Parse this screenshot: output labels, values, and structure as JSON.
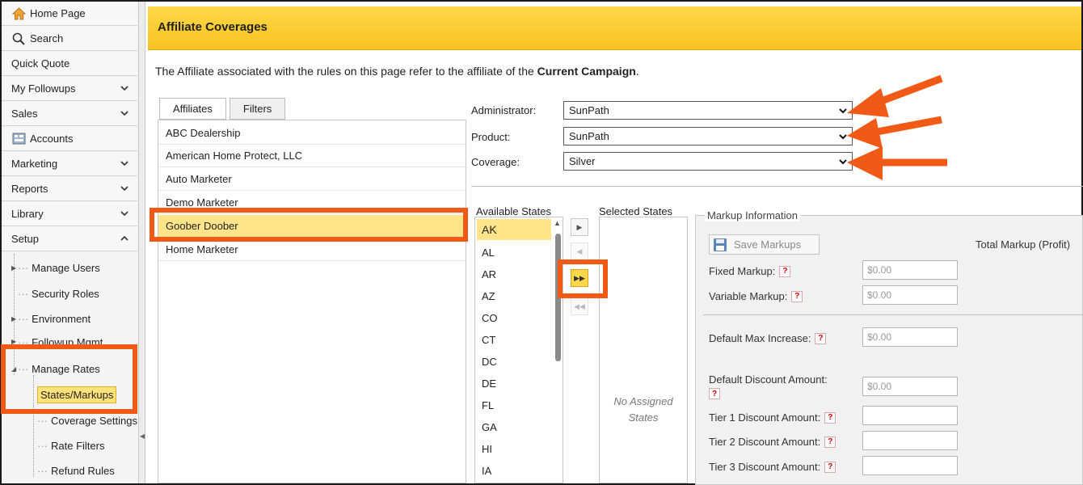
{
  "sidebar": {
    "items": [
      {
        "label": "Home Page",
        "icon": "home-icon"
      },
      {
        "label": "Search",
        "icon": "search-icon"
      },
      {
        "label": "Quick Quote"
      },
      {
        "label": "My Followups",
        "chevron": "down"
      },
      {
        "label": "Sales",
        "chevron": "down"
      },
      {
        "label": "Accounts",
        "icon": "accounts-icon"
      },
      {
        "label": "Marketing",
        "chevron": "down"
      },
      {
        "label": "Reports",
        "chevron": "down"
      },
      {
        "label": "Library",
        "chevron": "down"
      },
      {
        "label": "Setup",
        "chevron": "up"
      }
    ],
    "tree": [
      {
        "label": "Manage Users"
      },
      {
        "label": "Security Roles"
      },
      {
        "label": "Environment"
      },
      {
        "label": "Followup Mgmt"
      },
      {
        "label": "Manage Rates"
      },
      {
        "label": "States/Markups",
        "selected": true
      },
      {
        "label": "Coverage Settings"
      },
      {
        "label": "Rate Filters"
      },
      {
        "label": "Refund Rules"
      }
    ]
  },
  "page": {
    "title": "Affiliate Coverages",
    "intro_prefix": "The Affiliate associated with the rules on this page refer to the affiliate of the ",
    "intro_bold": "Current Campaign",
    "intro_suffix": "."
  },
  "tabs": [
    {
      "label": "Affiliates",
      "active": true
    },
    {
      "label": "Filters",
      "active": false
    }
  ],
  "affiliates": [
    "ABC Dealership",
    "American Home Protect, LLC",
    "Auto Marketer",
    "Demo Marketer",
    "Goober Doober",
    "Home Marketer"
  ],
  "selected_affiliate": "Goober Doober",
  "form": {
    "administrator": {
      "label": "Administrator:",
      "value": "SunPath"
    },
    "product": {
      "label": "Product:",
      "value": "SunPath"
    },
    "coverage": {
      "label": "Coverage:",
      "value": "Silver"
    }
  },
  "states": {
    "available_label": "Available States",
    "selected_label": "Selected States",
    "available": [
      "AK",
      "AL",
      "AR",
      "AZ",
      "CO",
      "CT",
      "DC",
      "DE",
      "FL",
      "GA",
      "HI",
      "IA"
    ],
    "empty_text": "No Assigned States"
  },
  "markup": {
    "legend": "Markup Information",
    "save_label": "Save Markups",
    "total_label": "Total Markup (Profit)",
    "fixed_label": "Fixed Markup:",
    "fixed_value": "$0.00",
    "variable_label": "Variable Markup:",
    "variable_value": "$0.00",
    "max_increase_label": "Default Max Increase:",
    "max_increase_value": "$0.00",
    "discount_label": "Default Discount Amount:",
    "discount_value": "$0.00",
    "tier1_label": "Tier 1 Discount Amount:",
    "tier2_label": "Tier 2 Discount Amount:",
    "tier3_label": "Tier 3 Discount Amount:",
    "help_glyph": "?"
  },
  "colors": {
    "accent": "#f7c320",
    "highlight": "#f05a16",
    "selection": "#ffe48a"
  }
}
